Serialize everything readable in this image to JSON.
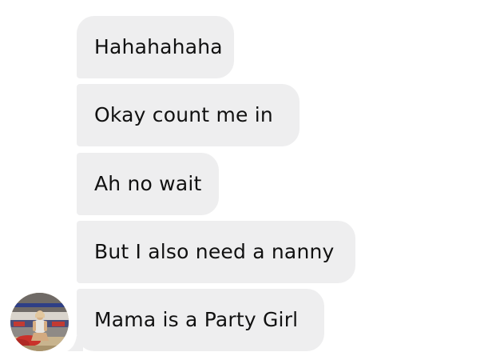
{
  "conversation": {
    "messages": [
      {
        "text": "Hahahahaha"
      },
      {
        "text": "Okay count me in"
      },
      {
        "text": "Ah no wait"
      },
      {
        "text": "But I also need a nanny"
      },
      {
        "text": "Mama is a Party Girl"
      }
    ],
    "bubble_color": "#eeeeef",
    "text_color": "#111111"
  },
  "sender": {
    "avatar_icon": "profile-photo"
  }
}
